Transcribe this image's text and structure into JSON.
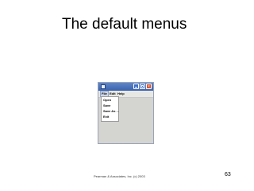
{
  "slide": {
    "title": "The default menus",
    "footer": "Pearman & Associates, Inc. (c) 2003",
    "page_number": "63"
  },
  "window": {
    "icon": "java-cup-icon",
    "controls": [
      "minimize-icon",
      "maximize-icon",
      "close-icon"
    ],
    "close_glyph": "×",
    "menubar": {
      "items": [
        {
          "label": "File"
        },
        {
          "label": "Edit"
        },
        {
          "label": "Help"
        }
      ]
    },
    "file_menu": {
      "items": [
        {
          "label": "Open"
        },
        {
          "label": "Save"
        },
        {
          "label": "Save As ..."
        },
        {
          "label": "Exit"
        }
      ]
    }
  },
  "colors": {
    "titlebar": "#3a62ad",
    "close_button": "#d9532e",
    "client_area": "#d4d4d0"
  }
}
